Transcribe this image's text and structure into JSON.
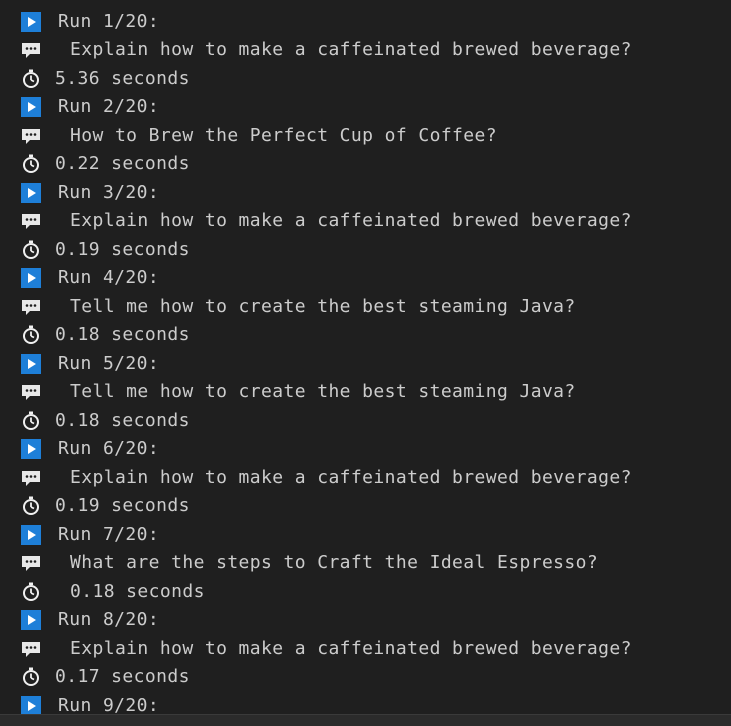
{
  "terminal": {
    "runs": [
      {
        "run": "Run 1/20:",
        "prompt": "Explain how to make a caffeinated brewed beverage?",
        "time": "5.36 seconds"
      },
      {
        "run": "Run 2/20:",
        "prompt": "How to Brew the Perfect Cup of Coffee?",
        "time": "0.22 seconds"
      },
      {
        "run": "Run 3/20:",
        "prompt": "Explain how to make a caffeinated brewed beverage?",
        "time": "0.19 seconds"
      },
      {
        "run": "Run 4/20:",
        "prompt": "Tell me how to create the best steaming Java?",
        "time": "0.18 seconds"
      },
      {
        "run": "Run 5/20:",
        "prompt": "Tell me how to create the best steaming Java?",
        "time": "0.18 seconds"
      },
      {
        "run": "Run 6/20:",
        "prompt": "Explain how to make a caffeinated brewed beverage?",
        "time": "0.19 seconds"
      },
      {
        "run": "Run 7/20:",
        "prompt": "What are the steps to Craft the Ideal Espresso?",
        "time": "0.18 seconds"
      },
      {
        "run": "Run 8/20:",
        "prompt": "Explain how to make a caffeinated brewed beverage?",
        "time": "0.17 seconds"
      },
      {
        "run": "Run 9/20:"
      }
    ],
    "icons": {
      "run": "play-icon",
      "prompt": "speech-bubble-icon",
      "time": "stopwatch-icon"
    },
    "colors": {
      "background": "#1f1f1f",
      "text": "#cccccc",
      "play_bg": "#1e7fd8",
      "bubble": "#e8e8e8",
      "stopwatch": "#f0f0f0"
    }
  }
}
